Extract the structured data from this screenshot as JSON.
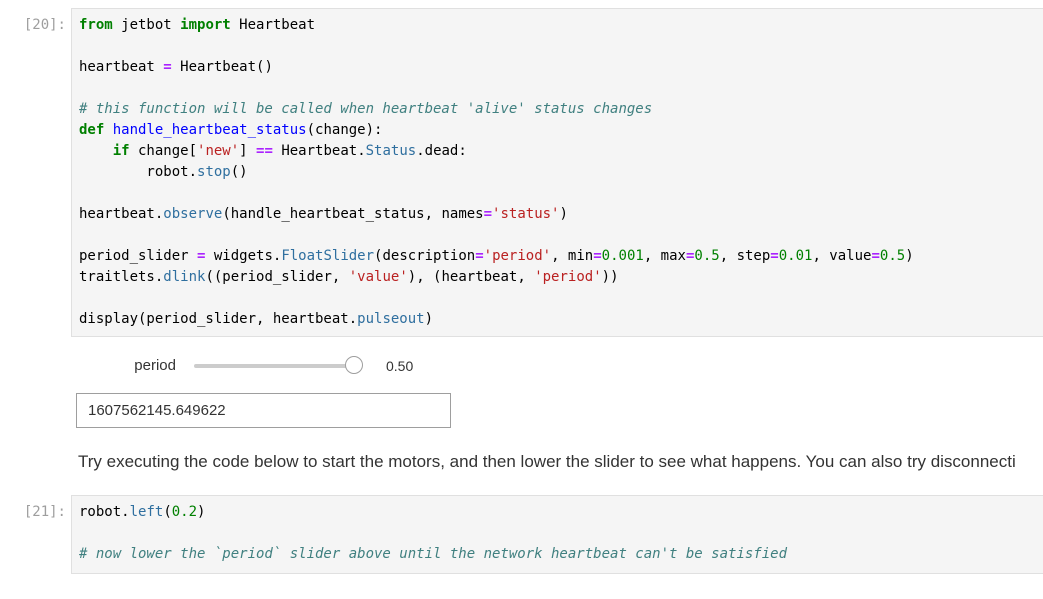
{
  "cell20": {
    "prompt": "[20]:",
    "lines": [
      [
        {
          "t": "from",
          "c": "kw"
        },
        {
          "t": " jetbot ",
          "c": "nm"
        },
        {
          "t": "import",
          "c": "kw"
        },
        {
          "t": " Heartbeat",
          "c": "nm"
        }
      ],
      [],
      [
        {
          "t": "heartbeat ",
          "c": "nm"
        },
        {
          "t": "=",
          "c": "op"
        },
        {
          "t": " Heartbeat()",
          "c": "nm"
        }
      ],
      [],
      [
        {
          "t": "# this function will be called when heartbeat 'alive' status changes",
          "c": "cm"
        }
      ],
      [
        {
          "t": "def",
          "c": "kw"
        },
        {
          "t": " ",
          "c": "nm"
        },
        {
          "t": "handle_heartbeat_status",
          "c": "fn"
        },
        {
          "t": "(change):",
          "c": "nm"
        }
      ],
      [
        {
          "t": "    ",
          "c": "nm"
        },
        {
          "t": "if",
          "c": "kw"
        },
        {
          "t": " change[",
          "c": "nm"
        },
        {
          "t": "'new'",
          "c": "str"
        },
        {
          "t": "] ",
          "c": "nm"
        },
        {
          "t": "==",
          "c": "op"
        },
        {
          "t": " Heartbeat",
          "c": "nm"
        },
        {
          "t": ".",
          "c": "nm"
        },
        {
          "t": "Status",
          "c": "attr"
        },
        {
          "t": ".",
          "c": "nm"
        },
        {
          "t": "dead:",
          "c": "nm"
        }
      ],
      [
        {
          "t": "        robot",
          "c": "nm"
        },
        {
          "t": ".",
          "c": "nm"
        },
        {
          "t": "stop",
          "c": "attr"
        },
        {
          "t": "()",
          "c": "nm"
        }
      ],
      [],
      [
        {
          "t": "heartbeat",
          "c": "nm"
        },
        {
          "t": ".",
          "c": "nm"
        },
        {
          "t": "observe",
          "c": "attr"
        },
        {
          "t": "(handle_heartbeat_status, names",
          "c": "nm"
        },
        {
          "t": "=",
          "c": "op"
        },
        {
          "t": "'status'",
          "c": "str"
        },
        {
          "t": ")",
          "c": "nm"
        }
      ],
      [],
      [
        {
          "t": "period_slider ",
          "c": "nm"
        },
        {
          "t": "=",
          "c": "op"
        },
        {
          "t": " widgets",
          "c": "nm"
        },
        {
          "t": ".",
          "c": "nm"
        },
        {
          "t": "FloatSlider",
          "c": "attr"
        },
        {
          "t": "(description",
          "c": "nm"
        },
        {
          "t": "=",
          "c": "op"
        },
        {
          "t": "'period'",
          "c": "str"
        },
        {
          "t": ", min",
          "c": "nm"
        },
        {
          "t": "=",
          "c": "op"
        },
        {
          "t": "0.001",
          "c": "num"
        },
        {
          "t": ", max",
          "c": "nm"
        },
        {
          "t": "=",
          "c": "op"
        },
        {
          "t": "0.5",
          "c": "num"
        },
        {
          "t": ", step",
          "c": "nm"
        },
        {
          "t": "=",
          "c": "op"
        },
        {
          "t": "0.01",
          "c": "num"
        },
        {
          "t": ", value",
          "c": "nm"
        },
        {
          "t": "=",
          "c": "op"
        },
        {
          "t": "0.5",
          "c": "num"
        },
        {
          "t": ")",
          "c": "nm"
        }
      ],
      [
        {
          "t": "traitlets",
          "c": "nm"
        },
        {
          "t": ".",
          "c": "nm"
        },
        {
          "t": "dlink",
          "c": "attr"
        },
        {
          "t": "((period_slider, ",
          "c": "nm"
        },
        {
          "t": "'value'",
          "c": "str"
        },
        {
          "t": "), (heartbeat, ",
          "c": "nm"
        },
        {
          "t": "'period'",
          "c": "str"
        },
        {
          "t": "))",
          "c": "nm"
        }
      ],
      [],
      [
        {
          "t": "display(period_slider, heartbeat",
          "c": "nm"
        },
        {
          "t": ".",
          "c": "nm"
        },
        {
          "t": "pulseout",
          "c": "attr"
        },
        {
          "t": ")",
          "c": "nm"
        }
      ]
    ]
  },
  "widget": {
    "slider_label": "period",
    "slider_value_text": "0.50",
    "slider_fraction": 1.0,
    "pulseout_value": "1607562145.649622"
  },
  "markdown": {
    "text": "Try executing the code below to start the motors, and then lower the slider to see what happens. You can also try disconnecti"
  },
  "cell21": {
    "prompt": "[21]:",
    "lines": [
      [
        {
          "t": "robot",
          "c": "nm"
        },
        {
          "t": ".",
          "c": "nm"
        },
        {
          "t": "left",
          "c": "attr"
        },
        {
          "t": "(",
          "c": "nm"
        },
        {
          "t": "0.2",
          "c": "num"
        },
        {
          "t": ")",
          "c": "nm"
        }
      ],
      [],
      [
        {
          "t": "# now lower the `period` slider above until the network heartbeat can't be satisfied",
          "c": "cm"
        }
      ]
    ]
  }
}
